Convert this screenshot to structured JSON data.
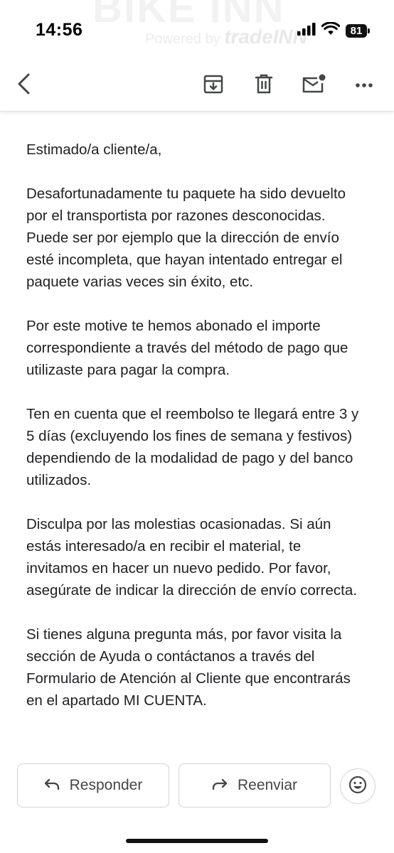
{
  "status_bar": {
    "time": "14:56",
    "battery": "81",
    "banner_ghost": "BIKE INN",
    "banner_powered_prefix": "Powered by",
    "banner_powered_brand": "tradeINN"
  },
  "toolbar": {
    "icons": [
      "back-arrow-icon",
      "archive-icon",
      "delete-icon",
      "mark-unread-icon",
      "more-icon"
    ]
  },
  "email": {
    "paragraphs": [
      "Estimado/a cliente/a,",
      "Desafortunadamente tu paquete ha sido devuelto por el transportista por razones desconocidas. Puede ser por ejemplo que la dirección de envío esté incompleta, que hayan intentado entregar el paquete varias veces sin éxito, etc.",
      "Por este motive te hemos abonado el importe correspondiente a través del método de pago que utilizaste para pagar la compra.",
      "Ten en cuenta que el reembolso te llegará entre 3 y 5 días (excluyendo los fines de semana y festivos) dependiendo de la modalidad de pago y del banco utilizados.",
      "Disculpa por las molestias ocasionadas. Si aún estás interesado/a en recibir el material, te invitamos en hacer un nuevo pedido. Por favor, asegúrate de indicar la dirección de envío correcta.",
      "Si tienes alguna pregunta más, por favor visita la sección de Ayuda o contáctanos a través del Formulario de Atención al Cliente que encontrarás en el apartado MI CUENTA."
    ]
  },
  "actions": {
    "reply_label": "Responder",
    "forward_label": "Reenviar"
  },
  "colors": {
    "text": "#202124",
    "icon": "#444746",
    "border": "#cfd3d6"
  }
}
